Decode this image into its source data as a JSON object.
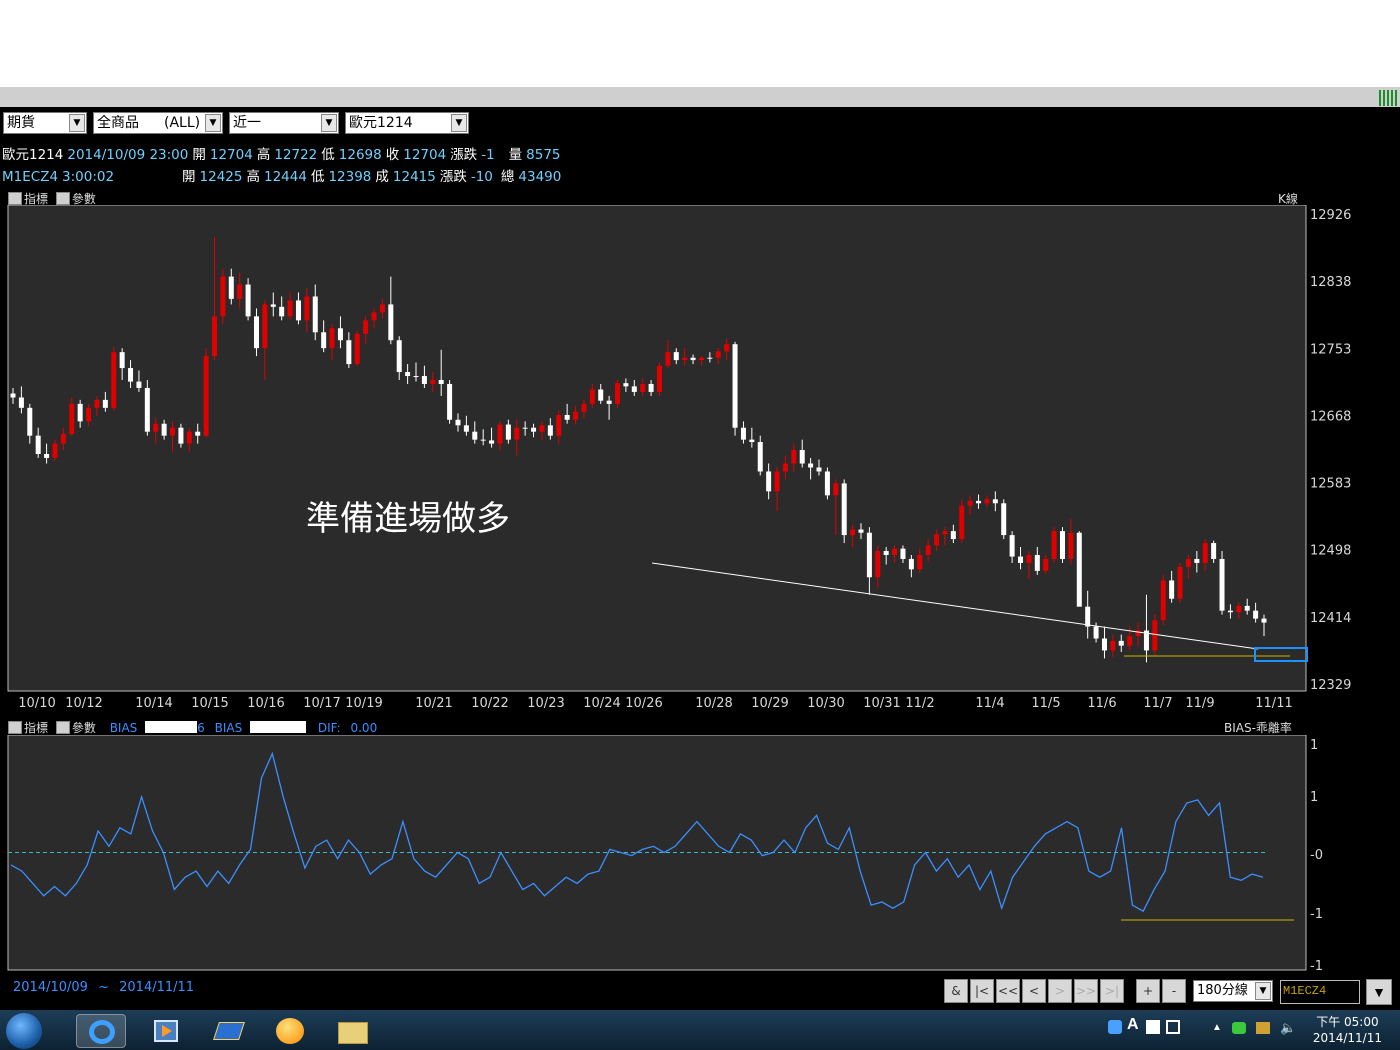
{
  "toolbar": {
    "market": "期貨",
    "product": "全商品",
    "product_filter": "(ALL)",
    "month": "近一",
    "contract": "歐元1214"
  },
  "quote1": {
    "name": "歐元1214",
    "datetime": "2014/10/09 23:00",
    "open_label": "開",
    "open": "12704",
    "high_label": "高",
    "high": "12722",
    "low_label": "低",
    "low": "12698",
    "close_label": "收",
    "close": "12704",
    "change_label": "漲跌",
    "change": "-1",
    "volume_label": "量",
    "volume": "8575"
  },
  "quote2": {
    "name": "M1ECZ4",
    "time": "3:00:02",
    "open_label": "開",
    "open": "12425",
    "high_label": "高",
    "high": "12444",
    "low_label": "低",
    "low": "12398",
    "close_label": "成",
    "close": "12415",
    "change_label": "漲跌",
    "change": "-10",
    "total_label": "總",
    "total": "43490"
  },
  "main_panel": {
    "indicator_btn": "指標",
    "param_btn": "參數",
    "type_label": "K線",
    "annotation": "準備進場做多",
    "y_ticks": [
      "12926",
      "12838",
      "12753",
      "12668",
      "12583",
      "12498",
      "12414",
      "12329"
    ],
    "x_ticks": [
      "10/10",
      "10/12",
      "10/14",
      "10/15",
      "10/16",
      "10/17",
      "10/19",
      "10/21",
      "10/22",
      "10/23",
      "10/24",
      "10/26",
      "10/28",
      "10/29",
      "10/30",
      "10/31",
      "11/2",
      "11/4",
      "11/5",
      "11/6",
      "11/7",
      "11/9",
      "11/11"
    ]
  },
  "sub_panel": {
    "indicator_btn": "指標",
    "param_btn": "參數",
    "bias1_label": "BIAS",
    "bias1_value": "6",
    "bias2_label": "BIAS",
    "dif_label": "DIF:",
    "dif_value": "0.00",
    "type_label": "BIAS-乖離率",
    "y_ticks": [
      "1",
      "1",
      "-0",
      "-1",
      "-1"
    ]
  },
  "footer": {
    "date_start": "2014/10/09",
    "date_sep": "~",
    "date_end": "2014/11/11",
    "amp_btn": "&",
    "first_btn": "|<",
    "prev_page_btn": "<<",
    "prev_btn": "<",
    "next_btn": ">",
    "next_page_btn": ">>",
    "last_btn": ">|",
    "zoom_in_btn": "+",
    "zoom_out_btn": "-",
    "period": "180分線",
    "symbol_input": "M1ECZ4"
  },
  "taskbar": {
    "clock_period": "下午 05:00",
    "clock_date": "2014/11/11"
  },
  "colors": {
    "up": "#e00000",
    "down": "#ffffff",
    "bias_line": "#3b8fff",
    "zero_line": "#3fb7c9",
    "support_line": "#c8b400",
    "highlight_box": "#1e90ff"
  },
  "chart_data": [
    {
      "type": "candlestick",
      "title": "",
      "ylim": [
        12329,
        12940
      ],
      "candles": [
        [
          12703,
          12710,
          12690,
          12698
        ],
        [
          12698,
          12712,
          12678,
          12685
        ],
        [
          12685,
          12690,
          12640,
          12650
        ],
        [
          12650,
          12660,
          12622,
          12627
        ],
        [
          12627,
          12640,
          12615,
          12622
        ],
        [
          12622,
          12645,
          12618,
          12640
        ],
        [
          12640,
          12660,
          12632,
          12652
        ],
        [
          12652,
          12698,
          12650,
          12690
        ],
        [
          12690,
          12695,
          12660,
          12668
        ],
        [
          12668,
          12690,
          12662,
          12685
        ],
        [
          12685,
          12700,
          12675,
          12695
        ],
        [
          12695,
          12705,
          12680,
          12685
        ],
        [
          12685,
          12762,
          12682,
          12755
        ],
        [
          12755,
          12760,
          12720,
          12735
        ],
        [
          12735,
          12745,
          12710,
          12718
        ],
        [
          12718,
          12732,
          12705,
          12710
        ],
        [
          12710,
          12720,
          12650,
          12655
        ],
        [
          12655,
          12672,
          12640,
          12665
        ],
        [
          12665,
          12670,
          12645,
          12650
        ],
        [
          12650,
          12668,
          12630,
          12660
        ],
        [
          12660,
          12665,
          12635,
          12640
        ],
        [
          12640,
          12660,
          12630,
          12655
        ],
        [
          12655,
          12665,
          12640,
          12650
        ],
        [
          12650,
          12760,
          12648,
          12750
        ],
        [
          12750,
          12900,
          12745,
          12800
        ],
        [
          12800,
          12860,
          12790,
          12850
        ],
        [
          12850,
          12860,
          12815,
          12822
        ],
        [
          12822,
          12855,
          12810,
          12840
        ],
        [
          12840,
          12848,
          12795,
          12800
        ],
        [
          12800,
          12810,
          12750,
          12760
        ],
        [
          12760,
          12820,
          12720,
          12815
        ],
        [
          12815,
          12830,
          12800,
          12812
        ],
        [
          12812,
          12825,
          12795,
          12800
        ],
        [
          12800,
          12830,
          12796,
          12820
        ],
        [
          12820,
          12830,
          12790,
          12795
        ],
        [
          12795,
          12835,
          12780,
          12825
        ],
        [
          12825,
          12840,
          12770,
          12780
        ],
        [
          12780,
          12795,
          12755,
          12760
        ],
        [
          12760,
          12790,
          12745,
          12785
        ],
        [
          12785,
          12800,
          12760,
          12770
        ],
        [
          12770,
          12780,
          12735,
          12740
        ],
        [
          12740,
          12782,
          12738,
          12778
        ],
        [
          12778,
          12800,
          12765,
          12795
        ],
        [
          12795,
          12810,
          12785,
          12805
        ],
        [
          12805,
          12822,
          12798,
          12815
        ],
        [
          12815,
          12850,
          12765,
          12770
        ],
        [
          12770,
          12775,
          12720,
          12730
        ],
        [
          12730,
          12740,
          12715,
          12725
        ],
        [
          12725,
          12742,
          12718,
          12725
        ],
        [
          12725,
          12738,
          12710,
          12715
        ],
        [
          12715,
          12730,
          12705,
          12720
        ],
        [
          12720,
          12758,
          12700,
          12715
        ],
        [
          12715,
          12720,
          12665,
          12670
        ],
        [
          12670,
          12678,
          12655,
          12663
        ],
        [
          12663,
          12675,
          12650,
          12655
        ],
        [
          12655,
          12668,
          12640,
          12645
        ],
        [
          12645,
          12658,
          12638,
          12644
        ],
        [
          12644,
          12660,
          12635,
          12640
        ],
        [
          12640,
          12668,
          12632,
          12664
        ],
        [
          12664,
          12670,
          12640,
          12645
        ],
        [
          12645,
          12670,
          12625,
          12660
        ],
        [
          12660,
          12668,
          12650,
          12660
        ],
        [
          12660,
          12665,
          12648,
          12655
        ],
        [
          12655,
          12668,
          12645,
          12663
        ],
        [
          12663,
          12672,
          12645,
          12650
        ],
        [
          12650,
          12682,
          12640,
          12676
        ],
        [
          12676,
          12690,
          12665,
          12670
        ],
        [
          12670,
          12688,
          12664,
          12680
        ],
        [
          12680,
          12695,
          12672,
          12690
        ],
        [
          12690,
          12715,
          12685,
          12708
        ],
        [
          12708,
          12715,
          12690,
          12694
        ],
        [
          12694,
          12700,
          12670,
          12690
        ],
        [
          12690,
          12720,
          12685,
          12716
        ],
        [
          12716,
          12722,
          12705,
          12712
        ],
        [
          12712,
          12720,
          12700,
          12705
        ],
        [
          12705,
          12722,
          12700,
          12715
        ],
        [
          12715,
          12720,
          12700,
          12705
        ],
        [
          12705,
          12742,
          12700,
          12738
        ],
        [
          12738,
          12770,
          12735,
          12755
        ],
        [
          12755,
          12760,
          12740,
          12745
        ],
        [
          12745,
          12760,
          12738,
          12748
        ],
        [
          12748,
          12752,
          12740,
          12745
        ],
        [
          12745,
          12750,
          12738,
          12748
        ],
        [
          12748,
          12755,
          12742,
          12748
        ],
        [
          12748,
          12760,
          12740,
          12756
        ],
        [
          12756,
          12772,
          12745,
          12765
        ],
        [
          12765,
          12768,
          12650,
          12660
        ],
        [
          12660,
          12668,
          12640,
          12645
        ],
        [
          12645,
          12660,
          12635,
          12642
        ],
        [
          12642,
          12650,
          12600,
          12605
        ],
        [
          12605,
          12615,
          12570,
          12580
        ],
        [
          12580,
          12610,
          12555,
          12605
        ],
        [
          12605,
          12625,
          12595,
          12615
        ],
        [
          12615,
          12640,
          12605,
          12632
        ],
        [
          12632,
          12645,
          12610,
          12615
        ],
        [
          12615,
          12622,
          12595,
          12610
        ],
        [
          12610,
          12620,
          12600,
          12605
        ],
        [
          12605,
          12610,
          12570,
          12575
        ],
        [
          12575,
          12595,
          12525,
          12590
        ],
        [
          12590,
          12595,
          12515,
          12525
        ],
        [
          12525,
          12538,
          12510,
          12532
        ],
        [
          12532,
          12540,
          12520,
          12528
        ],
        [
          12528,
          12535,
          12450,
          12472
        ],
        [
          12472,
          12512,
          12458,
          12505
        ],
        [
          12505,
          12510,
          12488,
          12500
        ],
        [
          12500,
          12512,
          12490,
          12508
        ],
        [
          12508,
          12512,
          12490,
          12495
        ],
        [
          12495,
          12500,
          12472,
          12482
        ],
        [
          12482,
          12508,
          12478,
          12500
        ],
        [
          12500,
          12520,
          12492,
          12512
        ],
        [
          12512,
          12532,
          12505,
          12526
        ],
        [
          12526,
          12535,
          12512,
          12530
        ],
        [
          12530,
          12538,
          12515,
          12520
        ],
        [
          12520,
          12570,
          12515,
          12562
        ],
        [
          12562,
          12575,
          12550,
          12568
        ],
        [
          12568,
          12576,
          12558,
          12565
        ],
        [
          12565,
          12575,
          12560,
          12570
        ],
        [
          12570,
          12580,
          12555,
          12565
        ],
        [
          12565,
          12570,
          12520,
          12525
        ],
        [
          12525,
          12530,
          12490,
          12498
        ],
        [
          12498,
          12510,
          12482,
          12490
        ],
        [
          12490,
          12505,
          12470,
          12500
        ],
        [
          12500,
          12510,
          12475,
          12480
        ],
        [
          12480,
          12500,
          12476,
          12495
        ],
        [
          12495,
          12535,
          12490,
          12530
        ],
        [
          12530,
          12535,
          12490,
          12495
        ],
        [
          12495,
          12545,
          12488,
          12528
        ],
        [
          12528,
          12530,
          12460,
          12435
        ],
        [
          12435,
          12455,
          12395,
          12410
        ],
        [
          12410,
          12415,
          12390,
          12395
        ],
        [
          12395,
          12410,
          12370,
          12380
        ],
        [
          12380,
          12400,
          12372,
          12392
        ],
        [
          12392,
          12400,
          12378,
          12386
        ],
        [
          12386,
          12410,
          12380,
          12398
        ],
        [
          12398,
          12415,
          12385,
          12405
        ],
        [
          12405,
          12450,
          12365,
          12380
        ],
        [
          12380,
          12425,
          12372,
          12418
        ],
        [
          12418,
          12475,
          12412,
          12468
        ],
        [
          12468,
          12480,
          12440,
          12445
        ],
        [
          12445,
          12490,
          12440,
          12485
        ],
        [
          12485,
          12500,
          12470,
          12495
        ],
        [
          12495,
          12505,
          12478,
          12490
        ],
        [
          12490,
          12520,
          12480,
          12515
        ],
        [
          12515,
          12518,
          12490,
          12495
        ],
        [
          12495,
          12505,
          12425,
          12430
        ],
        [
          12430,
          12438,
          12420,
          12428
        ],
        [
          12428,
          12440,
          12420,
          12436
        ],
        [
          12436,
          12445,
          12425,
          12430
        ],
        [
          12430,
          12440,
          12415,
          12420
        ],
        [
          12420,
          12425,
          12398,
          12415
        ]
      ]
    },
    {
      "type": "line",
      "title": "",
      "ylim": [
        -1.9,
        1.9
      ],
      "series": [
        {
          "values": [
            -0.2,
            -0.3,
            -0.5,
            -0.7,
            -0.55,
            -0.7,
            -0.5,
            -0.2,
            0.35,
            0.1,
            0.4,
            0.3,
            0.9,
            0.35,
            0.0,
            -0.6,
            -0.4,
            -0.3,
            -0.55,
            -0.3,
            -0.5,
            -0.2,
            0.05,
            1.2,
            1.6,
            0.9,
            0.3,
            -0.25,
            0.1,
            0.2,
            -0.1,
            0.2,
            0.0,
            -0.35,
            -0.2,
            -0.1,
            0.5,
            -0.1,
            -0.3,
            -0.4,
            -0.2,
            0.0,
            -0.1,
            -0.5,
            -0.4,
            0.0,
            -0.3,
            -0.6,
            -0.5,
            -0.7,
            -0.55,
            -0.4,
            -0.5,
            -0.35,
            -0.3,
            0.05,
            0.0,
            -0.05,
            0.05,
            0.1,
            0.0,
            0.1,
            0.3,
            0.5,
            0.3,
            0.1,
            0.0,
            0.3,
            0.2,
            -0.05,
            0.0,
            0.2,
            0.0,
            0.4,
            0.6,
            0.15,
            0.05,
            0.4,
            -0.3,
            -0.85,
            -0.8,
            -0.9,
            -0.8,
            -0.2,
            0.0,
            -0.3,
            -0.1,
            -0.4,
            -0.2,
            -0.6,
            -0.3,
            -0.9,
            -0.4,
            -0.15,
            0.1,
            0.3,
            0.4,
            0.5,
            0.4,
            -0.3,
            -0.4,
            -0.3,
            0.4,
            -0.85,
            -0.95,
            -0.6,
            -0.3,
            0.5,
            0.8,
            0.85,
            0.6,
            0.8,
            -0.4,
            -0.45,
            -0.35,
            -0.4
          ]
        }
      ]
    }
  ]
}
